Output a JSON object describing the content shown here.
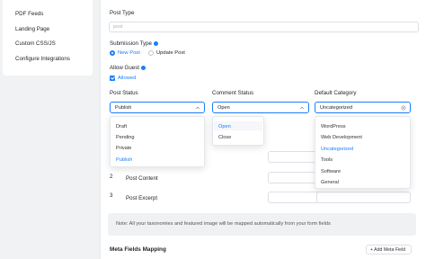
{
  "sidebar": {
    "items": [
      {
        "label": "PDF Feeds"
      },
      {
        "label": "Landing Page"
      },
      {
        "label": "Custom CSS/JS"
      },
      {
        "label": "Configure Integrations"
      }
    ]
  },
  "post_type": {
    "label": "Post Type",
    "value": "post"
  },
  "submission_type": {
    "label": "Submission Type",
    "options": [
      {
        "label": "New Post",
        "selected": true
      },
      {
        "label": "Update Post",
        "selected": false
      }
    ]
  },
  "allow_guest": {
    "label": "Allow Guest",
    "checkbox_label": "Allowed",
    "checked": true
  },
  "post_status": {
    "label": "Post Status",
    "value": "Publish",
    "options": [
      "Draft",
      "Pending",
      "Private",
      "Publish"
    ],
    "selected": "Publish"
  },
  "comment_status": {
    "label": "Comment Status",
    "value": "Open",
    "options": [
      "Open",
      "Close"
    ],
    "selected": "Open"
  },
  "default_category": {
    "label": "Default Category",
    "value": "Uncategorized",
    "options": [
      "WordPress",
      "Web Development",
      "Uncategorized",
      "Tools",
      "Software",
      "General"
    ],
    "selected": "Uncategorized"
  },
  "field_rows": [
    {
      "num": "2",
      "label": "Post Content"
    },
    {
      "num": "3",
      "label": "Post Excerpt"
    }
  ],
  "note": "Note: All your taxonomies and featured image will be mapped automatically from your form fields",
  "meta_fields": {
    "heading": "Meta Fields Mapping",
    "add_button": "+ Add Meta Field"
  },
  "colors": {
    "accent": "#1a7efb",
    "border": "#dcdfe6",
    "note_bg": "#f0f1f3"
  }
}
